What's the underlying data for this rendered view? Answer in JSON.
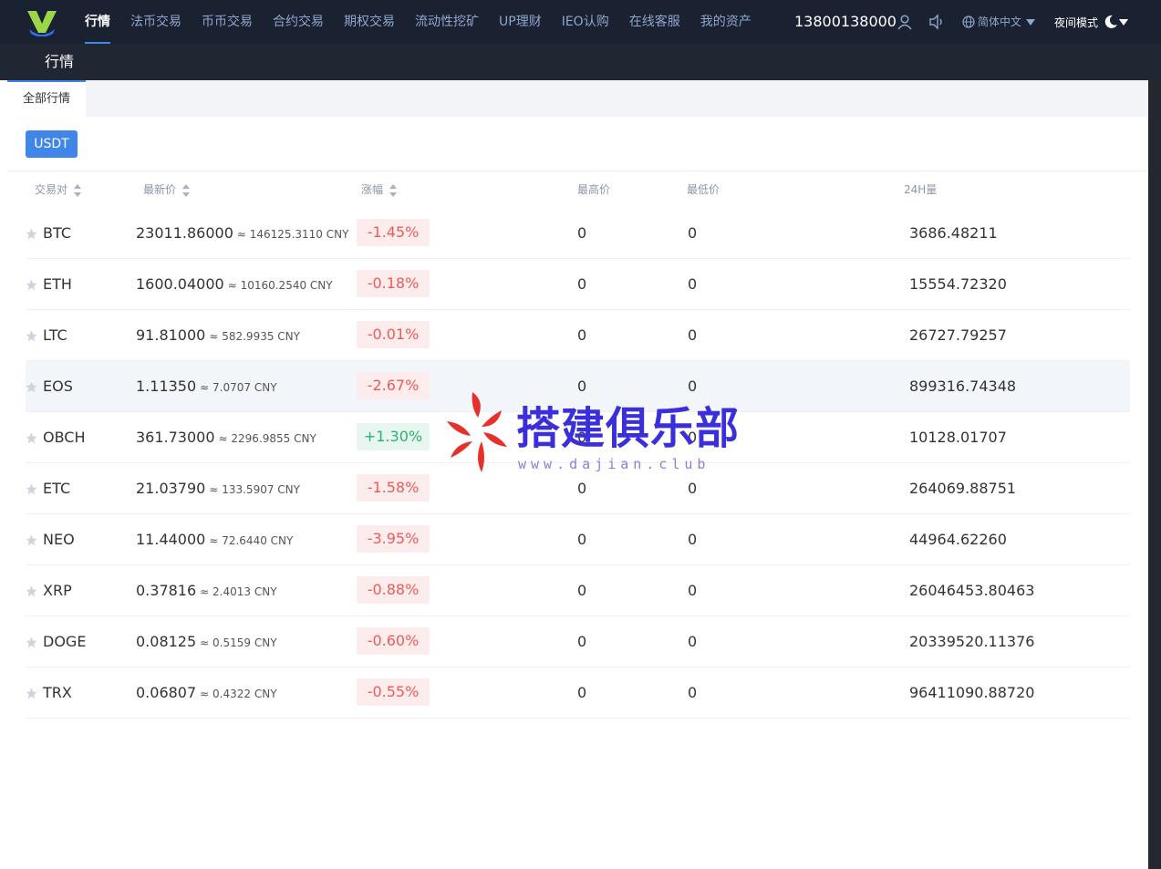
{
  "nav": {
    "items": [
      {
        "label": "行情",
        "active": true
      },
      {
        "label": "法币交易"
      },
      {
        "label": "币币交易"
      },
      {
        "label": "合约交易"
      },
      {
        "label": "期权交易"
      },
      {
        "label": "流动性挖矿"
      },
      {
        "label": "UP理财"
      },
      {
        "label": "IEO认购"
      },
      {
        "label": "在线客服"
      },
      {
        "label": "我的资产"
      }
    ],
    "phone": "13800138000",
    "language": "简体中文",
    "night_mode": "夜间模式",
    "icons": [
      "user-icon",
      "sound-icon",
      "globe-icon",
      "moon-icon"
    ]
  },
  "subheader": {
    "title": "行情"
  },
  "tabs": {
    "all_market": "全部行情"
  },
  "quote_button": "USDT",
  "table": {
    "headers": {
      "pair": "交易对",
      "last_price": "最新价",
      "change": "涨幅",
      "high": "最高价",
      "low": "最低价",
      "volume": "24H量"
    },
    "rows": [
      {
        "symbol": "BTC",
        "price": "23011.86000",
        "cny": "≈ 146125.3110 CNY",
        "change": "-1.45%",
        "high": "0",
        "low": "0",
        "volume": "3686.48211"
      },
      {
        "symbol": "ETH",
        "price": "1600.04000",
        "cny": "≈ 10160.2540 CNY",
        "change": "-0.18%",
        "high": "0",
        "low": "0",
        "volume": "15554.72320"
      },
      {
        "symbol": "LTC",
        "price": "91.81000",
        "cny": "≈ 582.9935 CNY",
        "change": "-0.01%",
        "high": "0",
        "low": "0",
        "volume": "26727.79257"
      },
      {
        "symbol": "EOS",
        "price": "1.11350",
        "cny": "≈ 7.0707 CNY",
        "change": "-2.67%",
        "high": "0",
        "low": "0",
        "volume": "899316.74348"
      },
      {
        "symbol": "OBCH",
        "price": "361.73000",
        "cny": "≈ 2296.9855 CNY",
        "change": "+1.30%",
        "high": "0",
        "low": "0",
        "volume": "10128.01707"
      },
      {
        "symbol": "ETC",
        "price": "21.03790",
        "cny": "≈ 133.5907 CNY",
        "change": "-1.58%",
        "high": "0",
        "low": "0",
        "volume": "264069.88751"
      },
      {
        "symbol": "NEO",
        "price": "11.44000",
        "cny": "≈ 72.6440 CNY",
        "change": "-3.95%",
        "high": "0",
        "low": "0",
        "volume": "44964.62260"
      },
      {
        "symbol": "XRP",
        "price": "0.37816",
        "cny": "≈ 2.4013 CNY",
        "change": "-0.88%",
        "high": "0",
        "low": "0",
        "volume": "26046453.80463"
      },
      {
        "symbol": "DOGE",
        "price": "0.08125",
        "cny": "≈ 0.5159 CNY",
        "change": "-0.60%",
        "high": "0",
        "low": "0",
        "volume": "20339520.11376"
      },
      {
        "symbol": "TRX",
        "price": "0.06807",
        "cny": "≈ 0.4322 CNY",
        "change": "-0.55%",
        "high": "0",
        "low": "0",
        "volume": "96411090.88720"
      }
    ]
  },
  "watermark": {
    "text": "搭建俱乐部",
    "url": "www.dajian.club"
  },
  "colors": {
    "accent": "#3f86e8",
    "nav_bg": "#1a2232",
    "negative": "#ec5b5b",
    "positive": "#2fae74"
  }
}
